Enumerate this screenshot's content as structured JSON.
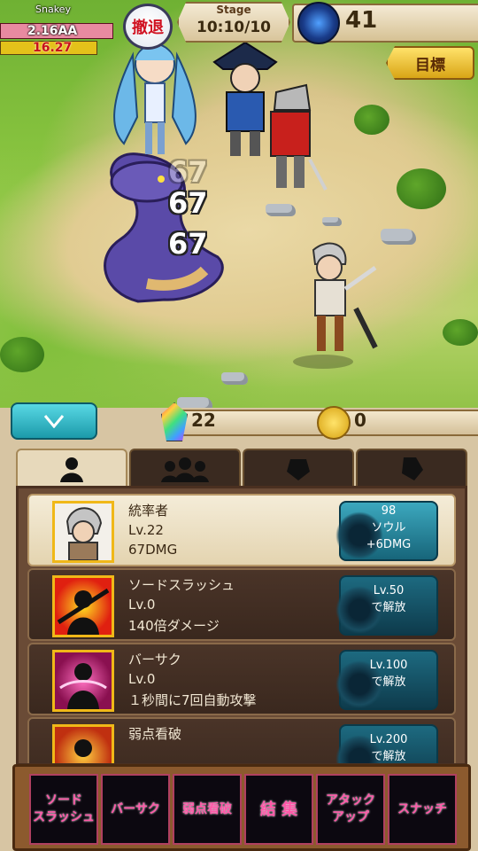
{
  "player": {
    "name": "Snakey",
    "hp": "2.16AA",
    "power": "16.27"
  },
  "hud": {
    "retreat_label": "撤退",
    "stage_label": "Stage",
    "stage_value": "10:10/10",
    "souls": "41",
    "goal_label": "目標"
  },
  "damage_numbers": [
    "67",
    "67",
    "67"
  ],
  "resources": {
    "crystals": "22",
    "gold": "0"
  },
  "tabs": [
    {
      "icon": "leader-silhouette-icon",
      "active": true
    },
    {
      "icon": "party-silhouette-icon",
      "active": false
    },
    {
      "icon": "item-silhouette-icon",
      "active": false
    },
    {
      "icon": "gem-silhouette-icon",
      "active": false
    }
  ],
  "rows": [
    {
      "title": "統率者",
      "level": "Lv.22",
      "desc": "67DMG",
      "button": [
        "98",
        "ソウル",
        "+6DMG"
      ],
      "leader": true
    },
    {
      "title": "ソードスラッシュ",
      "level": "Lv.0",
      "desc": "140倍ダメージ",
      "button": [
        "Lv.50",
        "で解放"
      ]
    },
    {
      "title": "バーサク",
      "level": "Lv.0",
      "desc": "１秒間に7回自動攻撃",
      "button": [
        "Lv.100",
        "で解放"
      ]
    },
    {
      "title": "弱点看破",
      "level": "",
      "desc": "",
      "button": [
        "Lv.200",
        "で解放"
      ]
    }
  ],
  "skills": [
    "ソード\nスラッシュ",
    "バーサク",
    "弱点看破",
    "結 集",
    "アタック\nアップ",
    "スナッチ"
  ],
  "colors": {
    "accent_teal": "#1c9aaa",
    "gold": "#f0b818",
    "skill_text": "#ff58a8"
  }
}
